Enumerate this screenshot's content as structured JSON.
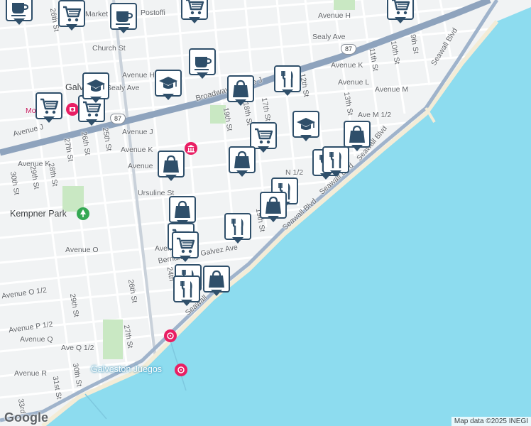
{
  "map": {
    "attribution": "Map data ©2025 INEGI",
    "logo_text": "Google",
    "colors": {
      "water": "#8ddcef",
      "land": "#f1f3f4",
      "highway": "#8ea3bd",
      "park": "#c9e8c3",
      "pin_border": "#2f4f6a"
    }
  },
  "labels": {
    "market_st": "Market St",
    "postoffice": "Postoffi",
    "avenue_h_top": "Avenue H",
    "sealy_ave_top": "Sealy Ave",
    "church_st": "Church St",
    "avenue_h": "Avenue H",
    "sealy_ave": "Sealy Ave",
    "galveston": "Galveston",
    "broadway": "Broadway Avenue J",
    "avenue_k": "Avenue K",
    "avenue_l": "Avenue L",
    "avenue_m": "Avenue M",
    "ave_m_half": "Ave M 1/2",
    "avenue_j": "Avenue J",
    "avenue_j_left": "Avenue J",
    "avenue_k_left": "Avenue K",
    "avenue_l_left": "Avenue",
    "avenue_n_half": "N 1/2",
    "ursuline": "Ursuline St",
    "kempner_park": "Kempner Park",
    "avenue_o": "Avenue O",
    "avenue_o_mid": "Avenue",
    "galvez": "Bernardo de Galvez Ave",
    "avenue_o_half": "Avenue O 1/2",
    "avenue_p_half": "Avenue P 1/2",
    "avenue_q": "Avenue Q",
    "ave_q_half": "Ave Q 1/2",
    "avenue_r": "Avenue R",
    "seawall_1": "Seawall Blvd",
    "seawall_2": "Seawall Blvd",
    "seawall_3": "Seawall Blvd",
    "seawall_4": "Seawall",
    "galveston_juegos": "Galveston Juegos",
    "moody_ma": "Moody Ma",
    "st_26_top": "26th St",
    "st_11": "11th St",
    "st_10": "10th St",
    "st_9": "9th St",
    "st_12": "12th St",
    "st_13": "13th St",
    "st_17": "17th St",
    "st_18": "18th St",
    "st_19": "19th St",
    "st_19_b": "19th St",
    "st_25": "25th St",
    "st_26": "26th St",
    "st_27": "27th St",
    "st_28": "28th St",
    "st_29": "29th St",
    "st_30": "30th St",
    "st_26_low": "26th St",
    "st_27_low": "27th St",
    "st_29_low": "29th St",
    "st_30_low": "30th St",
    "st_31": "31st St",
    "st_33": "33rd",
    "st_24": "24th",
    "hw_87_top": "87",
    "hw_87_left": "87"
  },
  "markers": [
    {
      "icon": "cafe"
    },
    {
      "icon": "shopping-cart"
    },
    {
      "icon": "cafe"
    },
    {
      "icon": "shopping-cart"
    },
    {
      "icon": "shopping-cart"
    },
    {
      "icon": "cafe"
    },
    {
      "icon": "graduation-cap"
    },
    {
      "icon": "shopping-bag"
    },
    {
      "icon": "restaurant"
    },
    {
      "icon": "shopping-cart"
    },
    {
      "icon": "shopping-cart"
    },
    {
      "icon": "graduation-cap"
    },
    {
      "icon": "shopping-bag"
    },
    {
      "icon": "restaurant"
    },
    {
      "icon": "restaurant"
    },
    {
      "icon": "shopping-cart"
    },
    {
      "icon": "graduation-cap"
    },
    {
      "icon": "shopping-bag"
    },
    {
      "icon": "shopping-bag"
    },
    {
      "icon": "shopping-bag"
    },
    {
      "icon": "restaurant"
    },
    {
      "icon": "shopping-bag"
    },
    {
      "icon": "restaurant"
    },
    {
      "icon": "shopping-cart"
    },
    {
      "icon": "shopping-cart"
    },
    {
      "icon": "restaurant"
    },
    {
      "icon": "restaurant"
    },
    {
      "icon": "shopping-bag"
    }
  ]
}
